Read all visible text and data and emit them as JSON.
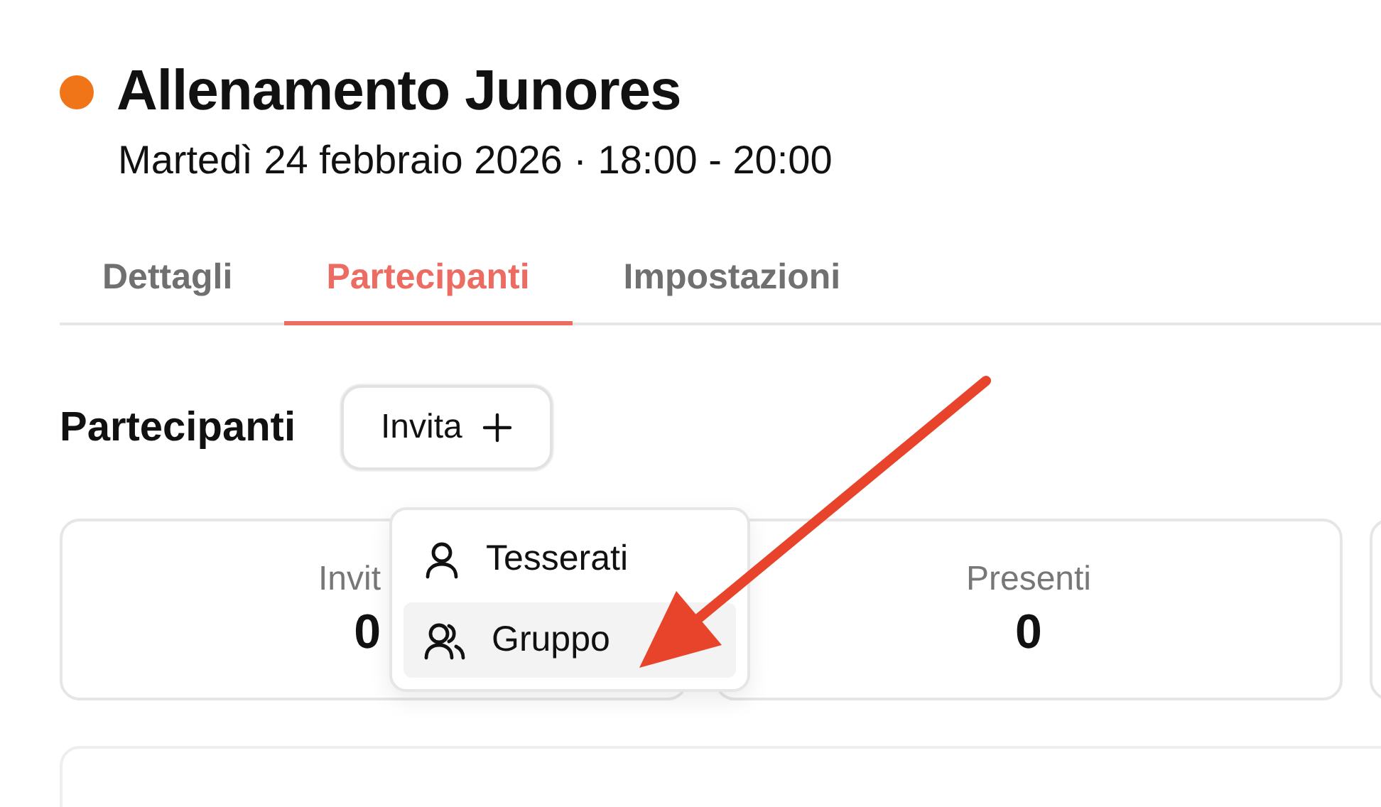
{
  "event": {
    "title": "Allenamento Junores",
    "status_dot": {
      "color": "#f07418"
    },
    "subtitle": "Martedì 24 febbraio 2026 · 18:00 - 20:00"
  },
  "tabs": [
    {
      "label": "Dettagli",
      "selected": false
    },
    {
      "label": "Partecipanti",
      "selected": true
    },
    {
      "label": "Impostazioni",
      "selected": false
    }
  ],
  "section": {
    "title": "Partecipanti",
    "invite_button": {
      "label": "Invita",
      "expanded": true
    }
  },
  "invite_menu": [
    {
      "label": "Tesserati",
      "kind": "single",
      "selected": false
    },
    {
      "label": "Gruppo",
      "kind": "group",
      "selected": true
    }
  ],
  "stats": [
    {
      "label": "Invit",
      "value": "0"
    },
    {
      "label": "Presenti",
      "value": "0"
    }
  ]
}
